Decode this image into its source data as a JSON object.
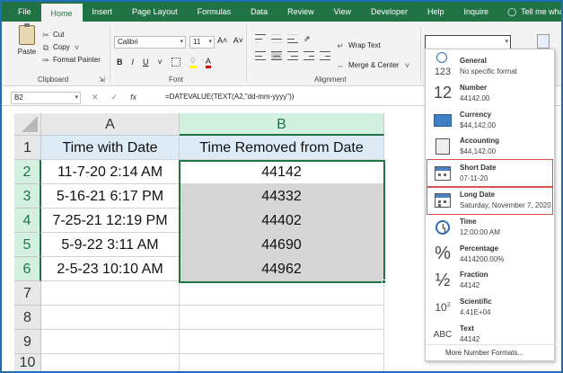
{
  "ribbon_tabs": [
    "File",
    "Home",
    "Insert",
    "Page Layout",
    "Formulas",
    "Data",
    "Review",
    "View",
    "Developer",
    "Help",
    "Inquire"
  ],
  "active_tab": "Home",
  "tell_me": "Tell me what you want to do",
  "clipboard": {
    "paste_label": "Paste",
    "cut_label": "Cut",
    "copy_label": "Copy",
    "format_painter_label": "Format Painter",
    "group_label": "Clipboard"
  },
  "font": {
    "name": "Calibri",
    "size": "11",
    "bold": "B",
    "italic": "I",
    "underline": "U",
    "group_label": "Font",
    "grow": "A˄",
    "shrink": "A˅"
  },
  "alignment": {
    "wrap_text_label": "Wrap Text",
    "merge_label": "Merge & Center",
    "group_label": "Alignment"
  },
  "formula_bar": {
    "name_box": "B2",
    "cancel": "✕",
    "enter": "✓",
    "fx": "fx",
    "formula": "=DATEVALUE(TEXT(A2,\"dd-mm-yyyy\"))"
  },
  "sheet": {
    "columns": [
      "A",
      "B"
    ],
    "row_numbers": [
      "1",
      "2",
      "3",
      "4",
      "5",
      "6",
      "7",
      "8",
      "9",
      "10"
    ],
    "headers": [
      "Time with Date",
      "Time Removed from Date"
    ],
    "rows": [
      [
        "11-7-20 2:14 AM",
        "44142"
      ],
      [
        "5-16-21 6:17 PM",
        "44332"
      ],
      [
        "7-25-21 12:19 PM",
        "44402"
      ],
      [
        "5-9-22 3:11 AM",
        "44690"
      ],
      [
        "2-5-23 10:10 AM",
        "44962"
      ]
    ]
  },
  "number_formats": [
    {
      "name": "General",
      "example": "No specific format",
      "icon": "general-icon"
    },
    {
      "name": "Number",
      "example": "44142.00",
      "icon": "number-icon"
    },
    {
      "name": "Currency",
      "example": "$44,142.00",
      "icon": "currency-icon"
    },
    {
      "name": "Accounting",
      "example": "$44,142.00",
      "icon": "accounting-icon"
    },
    {
      "name": "Short Date",
      "example": "07-11-20",
      "icon": "calendar-icon"
    },
    {
      "name": "Long Date",
      "example": "Saturday, November 7, 2020",
      "icon": "calendar-icon"
    },
    {
      "name": "Time",
      "example": "12:00:00 AM",
      "icon": "clock-icon"
    },
    {
      "name": "Percentage",
      "example": "4414200.00%",
      "icon": "percent-icon"
    },
    {
      "name": "Fraction",
      "example": "44142",
      "icon": "fraction-icon"
    },
    {
      "name": "Scientific",
      "example": "4.41E+04",
      "icon": "scientific-icon"
    },
    {
      "name": "Text",
      "example": "44142",
      "icon": "text-icon"
    }
  ],
  "number_format_glyphs": {
    "number": "12",
    "percent": "%",
    "fraction": "½",
    "scientific_base": "10",
    "scientific_exp": "2",
    "text": "ABC",
    "general_digits": "123"
  },
  "more_formats": "More Number Formats...",
  "colors": {
    "excel_green": "#217346",
    "header_fill": "#ddebf7",
    "range_fill": "#d6d6d6",
    "highlight_box": "#d9534f"
  }
}
